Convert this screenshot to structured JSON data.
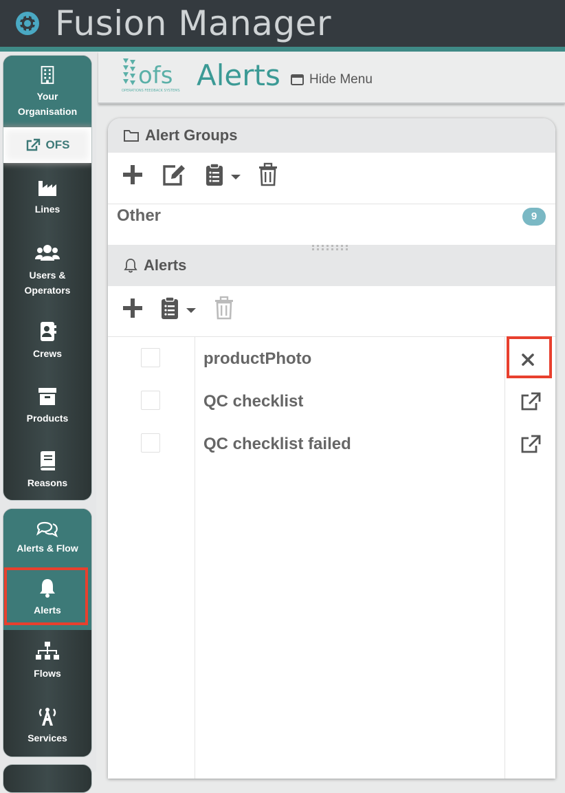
{
  "app": {
    "title": "Fusion Manager",
    "accent_color": "#3f8a86",
    "topbar_color": "#343a3f"
  },
  "sidebar": {
    "org_panel": {
      "items": [
        {
          "label": "Your Organisation",
          "icon": "building-icon"
        },
        {
          "label": "OFS",
          "icon": "external-link-icon"
        },
        {
          "label": "Lines",
          "icon": "factory-icon"
        },
        {
          "label": "Users & Operators",
          "icon": "users-icon"
        },
        {
          "label": "Crews",
          "icon": "address-book-icon"
        },
        {
          "label": "Products",
          "icon": "archive-box-icon"
        },
        {
          "label": "Reasons",
          "icon": "book-icon"
        }
      ]
    },
    "flow_panel": {
      "items": [
        {
          "label": "Alerts & Flow",
          "icon": "comments-icon"
        },
        {
          "label": "Alerts",
          "icon": "bell-icon",
          "active": true
        },
        {
          "label": "Flows",
          "icon": "sitemap-icon"
        },
        {
          "label": "Services",
          "icon": "broadcast-tower-icon"
        }
      ]
    }
  },
  "header": {
    "logo_text": "ofs",
    "logo_subtext": "OPERATIONS FEEDBACK SYSTEMS",
    "title": "Alerts",
    "hide_menu_label": "Hide Menu"
  },
  "alert_groups": {
    "title": "Alert Groups",
    "groups": [
      {
        "name": "Other",
        "count": "9"
      }
    ]
  },
  "alerts": {
    "title": "Alerts",
    "items": [
      {
        "name": "productPhoto",
        "action": "close-icon"
      },
      {
        "name": "QC checklist",
        "action": "external-link-icon"
      },
      {
        "name": "QC checklist failed",
        "action": "external-link-icon"
      }
    ]
  },
  "colors": {
    "highlight": "#e8402e",
    "teal": "#3d7a78",
    "badge": "#7ab8c4"
  }
}
